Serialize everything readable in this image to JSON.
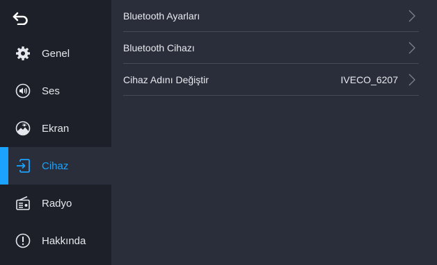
{
  "sidebar": {
    "items": [
      {
        "label": "Genel",
        "icon": "gear-icon"
      },
      {
        "label": "Ses",
        "icon": "speaker-icon"
      },
      {
        "label": "Ekran",
        "icon": "display-brightness-icon"
      },
      {
        "label": "Cihaz",
        "icon": "device-input-icon",
        "active": true
      },
      {
        "label": "Radyo",
        "icon": "radio-icon"
      },
      {
        "label": "Hakkında",
        "icon": "info-icon"
      }
    ]
  },
  "main": {
    "rows": [
      {
        "label": "Bluetooth Ayarları",
        "value": ""
      },
      {
        "label": "Bluetooth Cihazı",
        "value": ""
      },
      {
        "label": "Cihaz Adını Değiştir",
        "value": "IVECO_6207"
      }
    ]
  },
  "colors": {
    "accent": "#1aa3ff",
    "sidebar_bg": "#1e2029",
    "main_bg": "#2a2e3a",
    "divider": "#454a57"
  }
}
